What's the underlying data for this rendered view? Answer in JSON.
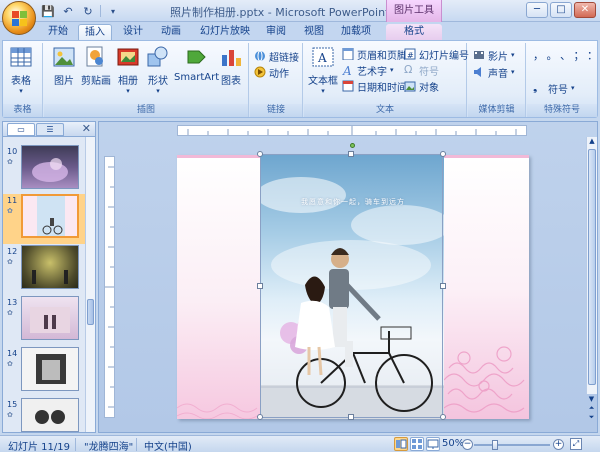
{
  "titlebar": {
    "title": "照片制作相册.pptx - Microsoft PowerPoint",
    "contextual_tab": "图片工具",
    "minimize": "─",
    "maximize": "□",
    "close": "✕"
  },
  "tabs": [
    {
      "label": "开始"
    },
    {
      "label": "插入",
      "active": true
    },
    {
      "label": "设计"
    },
    {
      "label": "动画"
    },
    {
      "label": "幻灯片放映"
    },
    {
      "label": "审阅"
    },
    {
      "label": "视图"
    },
    {
      "label": "加载项"
    },
    {
      "label": "格式"
    }
  ],
  "ribbon": {
    "groups": {
      "table": "表格",
      "illustrations": "插图",
      "links": "链接",
      "text": "文本",
      "media": "媒体剪辑",
      "special": "特殊符号"
    },
    "buttons": {
      "table": "表格",
      "picture": "图片",
      "clipart": "剪贴画",
      "album": "相册",
      "shapes": "形状",
      "smartart": "SmartArt",
      "chart": "图表",
      "hyperlink": "超链接",
      "action": "动作",
      "textbox": "文本框",
      "header_footer": "页眉和页脚",
      "wordart": "艺术字",
      "datetime": "日期和时间",
      "slide_number": "幻灯片编号",
      "symbol": "符号",
      "object": "对象",
      "movie": "影片",
      "sound": "声音",
      "special_symbol": "符号",
      "special_chars": "，。、；：？"
    }
  },
  "slides_panel": {
    "thumbnails": [
      {
        "num": "10"
      },
      {
        "num": "11",
        "selected": true
      },
      {
        "num": "12"
      },
      {
        "num": "13"
      },
      {
        "num": "14"
      },
      {
        "num": "15"
      }
    ]
  },
  "slide": {
    "caption": "我愿意和你一起，骑车到远方"
  },
  "statusbar": {
    "slide_info": "幻灯片 11/19",
    "theme": "\"龙腾四海\"",
    "language": "中文(中国)",
    "zoom": "50%"
  },
  "colors": {
    "accent_orange": "#f19a37",
    "ribbon_blue": "#15428b",
    "contextual_pink": "#e4b6e8",
    "slide_pink": "#f4c4de"
  }
}
